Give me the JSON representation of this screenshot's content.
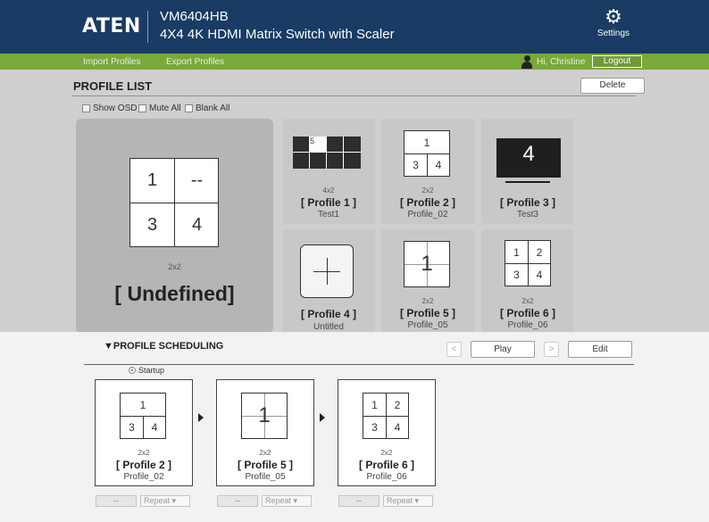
{
  "header": {
    "brand": "ATEN",
    "model": "VM6404HB",
    "description": "4X4 4K HDMI Matrix Switch with Scaler",
    "settings_label": "Settings"
  },
  "nav": {
    "import_label": "Import Profiles",
    "export_label": "Export Profiles",
    "greeting": "Hi, Christine",
    "logout_label": "Logout"
  },
  "profile_list": {
    "title": "PROFILE LIST",
    "delete_label": "Delete",
    "options": {
      "show_osd": "Show OSD",
      "mute_all": "Mute All",
      "blank_all": "Blank All"
    },
    "selected": {
      "layout": "2x2",
      "name": "[ Undefined]",
      "cells": [
        "1",
        "--",
        "3",
        "4"
      ]
    },
    "profiles": [
      {
        "layout": "4x2",
        "name": "[ Profile 1 ]",
        "sub": "Test1",
        "cells": [
          "5"
        ]
      },
      {
        "layout": "2x2",
        "name": "[ Profile 2 ]",
        "sub": "Profile_02",
        "cells": [
          "1",
          "3",
          "4"
        ]
      },
      {
        "layout": "",
        "name": "[ Profile 3 ]",
        "sub": "Test3",
        "cells": [
          "4"
        ]
      },
      {
        "layout": "",
        "name": "[ Profile 4 ]",
        "sub": "Untitled",
        "cells": []
      },
      {
        "layout": "2x2",
        "name": "[ Profile 5 ]",
        "sub": "Profile_05",
        "cells": [
          "1"
        ]
      },
      {
        "layout": "2x2",
        "name": "[ Profile 6 ]",
        "sub": "Profile_06",
        "cells": [
          "1",
          "2",
          "3",
          "4"
        ]
      }
    ]
  },
  "scheduling": {
    "title": "PROFILE SCHEDULING",
    "prev_label": "<",
    "play_label": "Play",
    "next_label": ">",
    "edit_label": "Edit",
    "startup_label": "Startup",
    "sequence": [
      {
        "layout": "2x2",
        "name": "[ Profile 2 ]",
        "sub": "Profile_02",
        "cells": [
          "1",
          "3",
          "4"
        ],
        "time": "--",
        "repeat": "Repeat"
      },
      {
        "layout": "2x2",
        "name": "[ Profile 5 ]",
        "sub": "Profile_05",
        "cells": [
          "1"
        ],
        "time": "--",
        "repeat": "Repeat"
      },
      {
        "layout": "2x2",
        "name": "[ Profile 6 ]",
        "sub": "Profile_06",
        "cells": [
          "1",
          "2",
          "3",
          "4"
        ],
        "time": "--",
        "repeat": "Repeat"
      }
    ]
  },
  "colors": {
    "header_bg": "#193b64",
    "nav_bg": "#79a83b",
    "panel_bg": "#cfcfcf",
    "selected_card_bg": "#b5b5b5"
  }
}
